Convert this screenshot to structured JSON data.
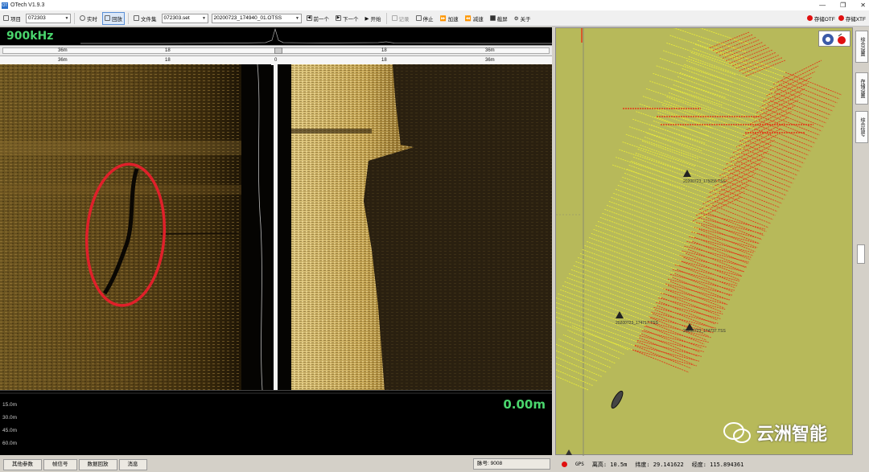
{
  "window": {
    "app_icon": "OT",
    "title": "OTech V1.9.3",
    "controls": [
      "—",
      "❐",
      "✕"
    ]
  },
  "toolbar": {
    "project_label": "项目",
    "project_value": "072303",
    "realtime_label": "实时",
    "replay_label": "回放",
    "file_label": "文件集",
    "fileset_value": "072303.set",
    "file_value": "20200723_174940_01.OTSS",
    "prev_label": "前一个",
    "next_label": "下一个",
    "start_label": "开始",
    "record_label": "记录",
    "stop_label": "停止",
    "faster_label": "加速",
    "slower_label": "减速",
    "screenshot_label": "截屏",
    "about_label": "关于",
    "save_otf_label": "存储OTF",
    "save_xtf_label": "存储XTF"
  },
  "sonar": {
    "frequency": "900kHz",
    "ruler_top": [
      "36m",
      "18",
      "0",
      "18",
      "36m"
    ],
    "ruler_bottom": [
      "36m",
      "18",
      "0",
      "18",
      "36m"
    ],
    "depth_ticks": [
      "15.0m",
      "30.0m",
      "45.0m",
      "60.0m"
    ],
    "depth_value": "0.00m"
  },
  "bottom_tabs": [
    "其他参数",
    "帧信号",
    "数据回放",
    "消息"
  ],
  "ping_label": "脉号: 9008",
  "map": {
    "targets": [
      "20200723_175056.TSS",
      "20200723_174717.TSS",
      "20200723_174737.TSS"
    ]
  },
  "side_tabs": [
    "综合设置",
    "存储设置",
    "综合信号"
  ],
  "status": {
    "gps_label": "GPS",
    "altitude": "离高: 10.5m",
    "latitude": "纬度: 29.141622",
    "longitude": "经度: 115.894361"
  },
  "watermark": "云洲智能",
  "colors": {
    "sonar_green": "#4ad66d",
    "map_bg": "#b7b95a",
    "track_red": "#e23a1a",
    "track_yellow": "#e8ea3a",
    "highlight_circle": "#e0202a"
  }
}
